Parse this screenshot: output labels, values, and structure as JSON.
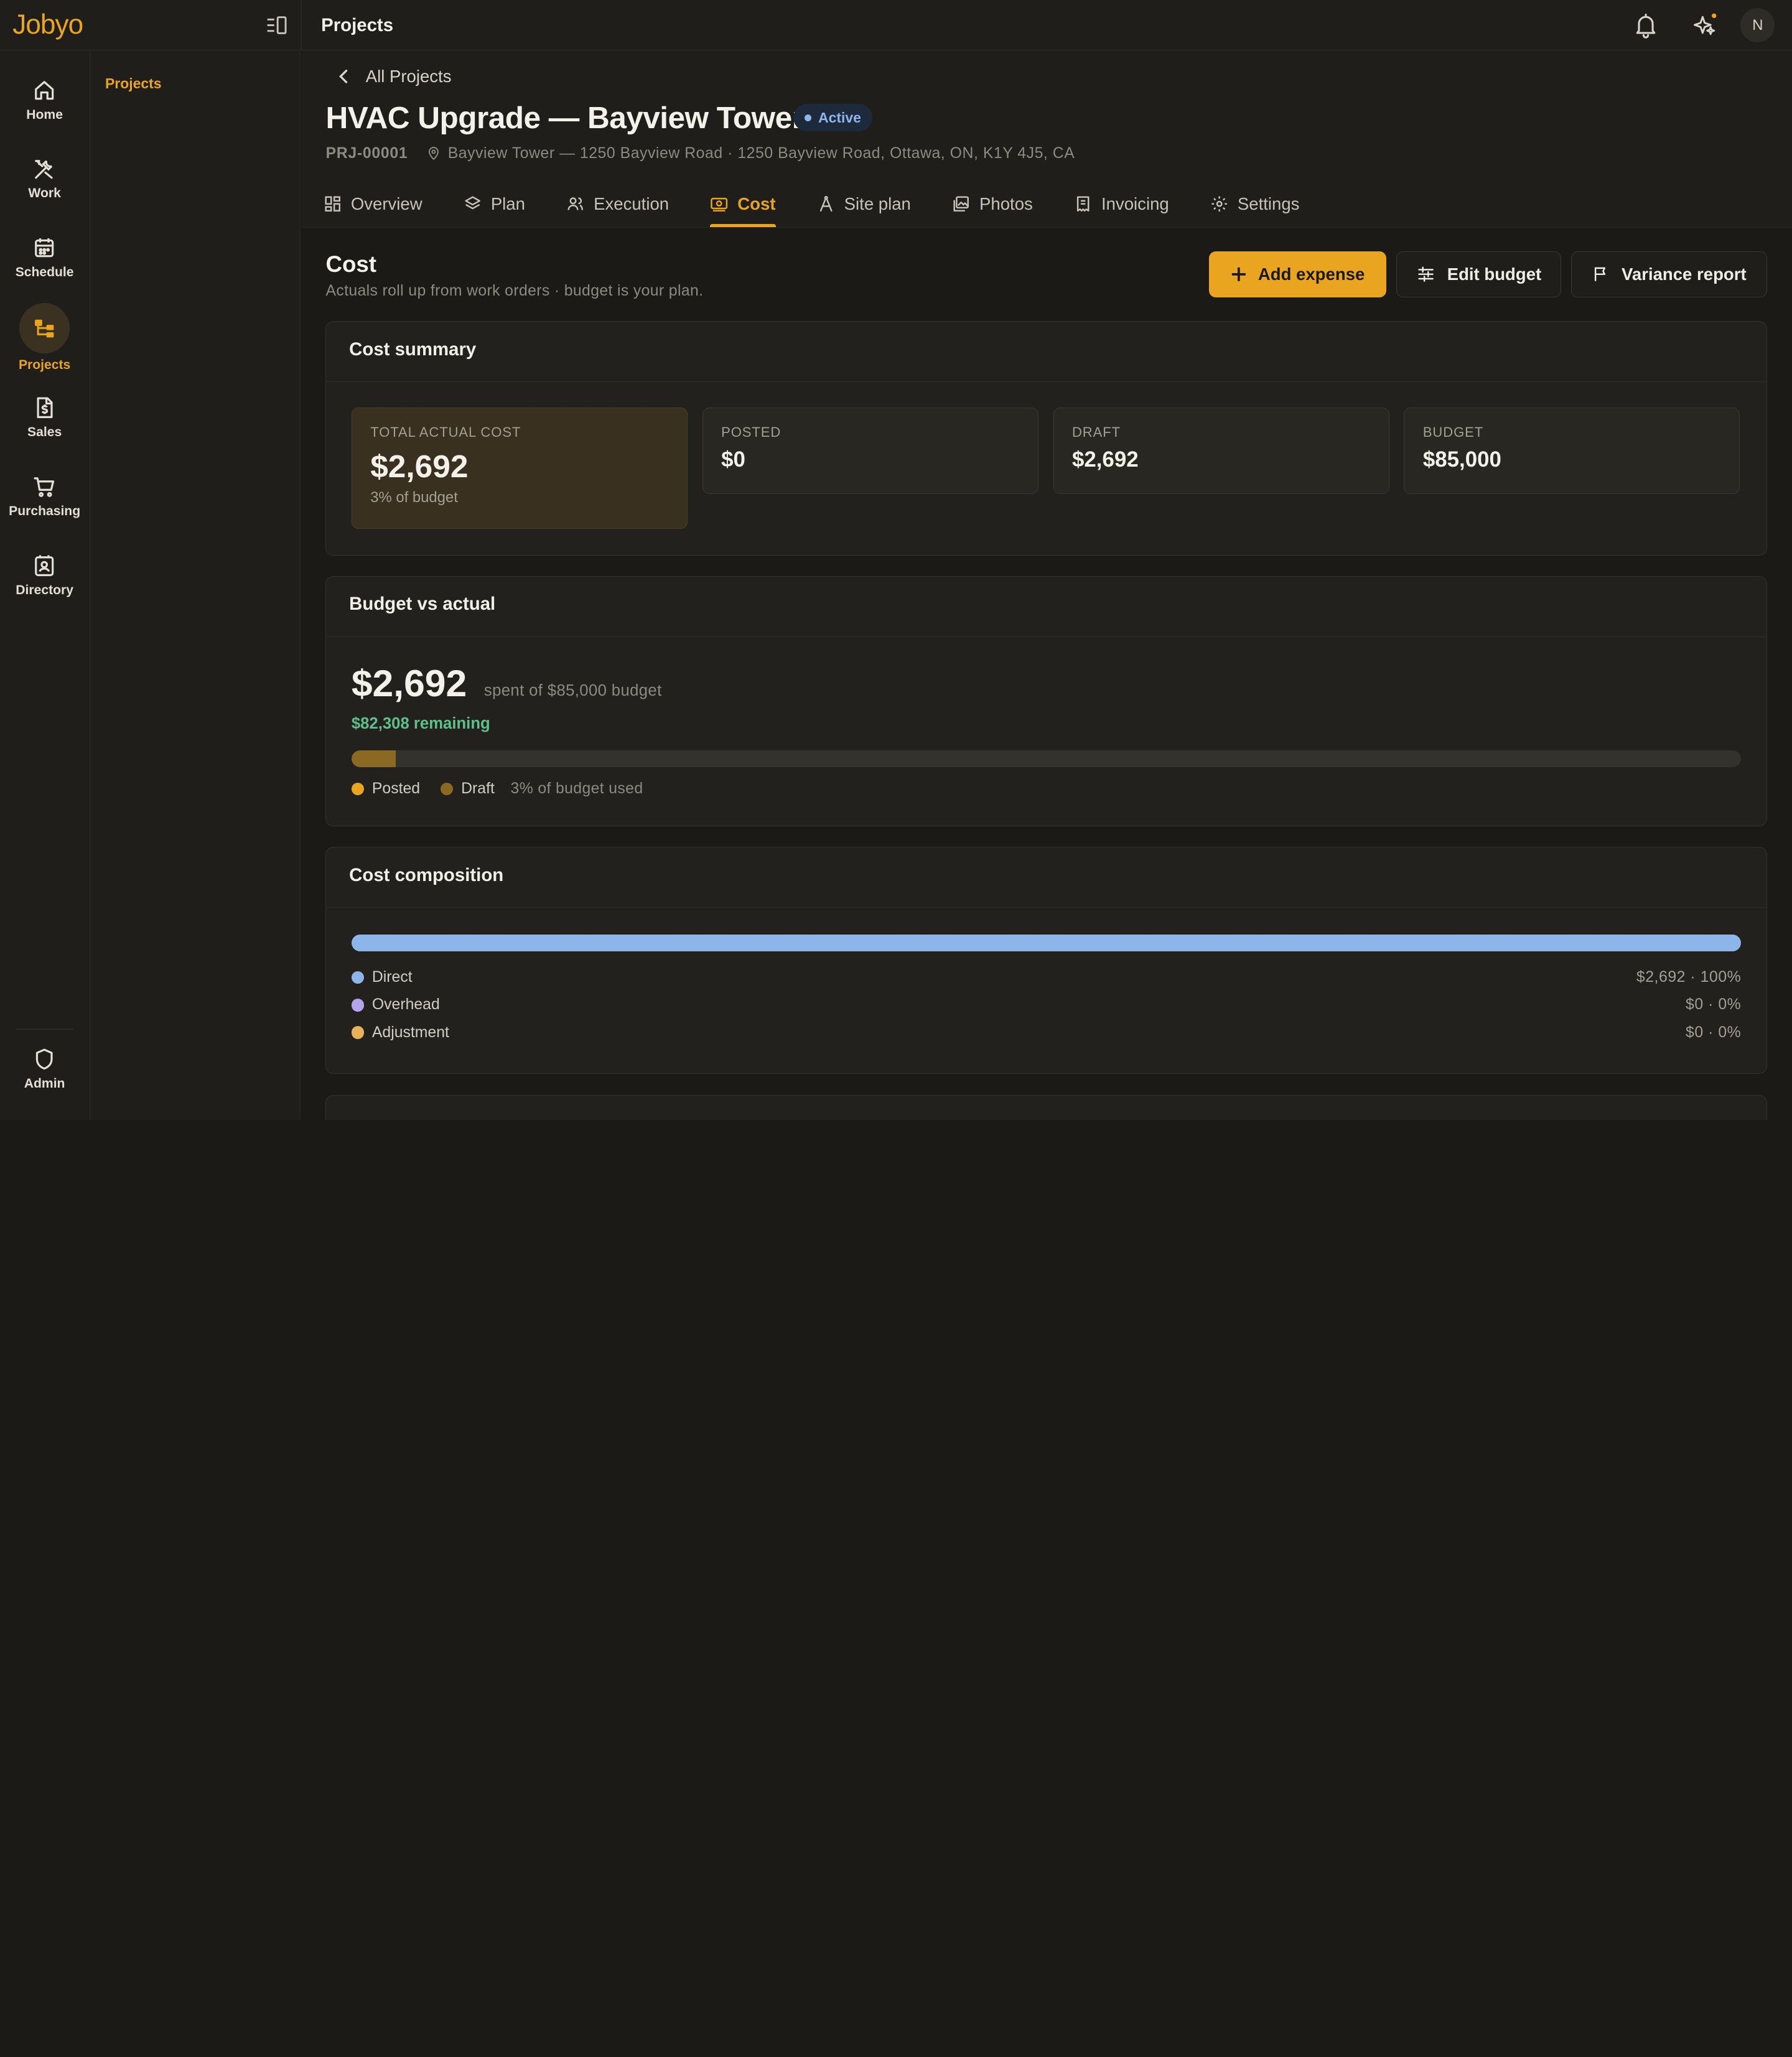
{
  "app": {
    "logo": "Jobyo",
    "top_title": "Projects",
    "avatar_initial": "N"
  },
  "rail": {
    "items": [
      {
        "label": "Home",
        "icon": "home-icon"
      },
      {
        "label": "Work",
        "icon": "tools-icon"
      },
      {
        "label": "Schedule",
        "icon": "calendar-icon"
      },
      {
        "label": "Projects",
        "icon": "projects-icon",
        "active": true
      },
      {
        "label": "Sales",
        "icon": "invoice-dollar-icon"
      },
      {
        "label": "Purchasing",
        "icon": "cart-icon"
      },
      {
        "label": "Directory",
        "icon": "contacts-icon"
      }
    ],
    "admin": {
      "label": "Admin",
      "icon": "shield-icon"
    }
  },
  "subnav": {
    "items": [
      {
        "label": "Projects",
        "active": true
      }
    ]
  },
  "project": {
    "back_label": "All Projects",
    "title": "HVAC Upgrade — Bayview Tower",
    "status": "Active",
    "code": "PRJ-00001",
    "address": "Bayview Tower — 1250 Bayview Road · 1250 Bayview Road, Ottawa, ON, K1Y 4J5, CA"
  },
  "tabs": [
    {
      "label": "Overview",
      "icon": "grid-icon"
    },
    {
      "label": "Plan",
      "icon": "layers-icon"
    },
    {
      "label": "Execution",
      "icon": "people-icon"
    },
    {
      "label": "Cost",
      "icon": "money-icon",
      "active": true
    },
    {
      "label": "Site plan",
      "icon": "compass-icon"
    },
    {
      "label": "Photos",
      "icon": "photos-icon"
    },
    {
      "label": "Invoicing",
      "icon": "receipt-icon"
    },
    {
      "label": "Settings",
      "icon": "gear-icon"
    }
  ],
  "cost": {
    "title": "Cost",
    "subtitle": "Actuals roll up from work orders · budget is your plan.",
    "actions": {
      "add_expense": "Add expense",
      "edit_budget": "Edit budget",
      "variance_report": "Variance report"
    }
  },
  "summary": {
    "title": "Cost summary",
    "stats": [
      {
        "label": "TOTAL ACTUAL COST",
        "value": "$2,692",
        "note": "3% of budget"
      },
      {
        "label": "POSTED",
        "value": "$0"
      },
      {
        "label": "DRAFT",
        "value": "$2,692"
      },
      {
        "label": "BUDGET",
        "value": "$85,000"
      }
    ]
  },
  "budget_vs_actual": {
    "title": "Budget vs actual",
    "spent": "$2,692",
    "spent_of": "spent of $85,000 budget",
    "remaining": "$82,308 remaining",
    "used_fraction": 0.032,
    "legend": {
      "posted": "Posted",
      "draft": "Draft",
      "used": "3% of budget used"
    }
  },
  "composition": {
    "title": "Cost composition",
    "rows": [
      {
        "label": "Direct",
        "value": "$2,692 · 100%",
        "color": "#8eb5ea"
      },
      {
        "label": "Overhead",
        "value": "$0 · 0%",
        "color": "#b6a4ea"
      },
      {
        "label": "Adjustment",
        "value": "$0 · 0%",
        "color": "#e9b25a"
      }
    ]
  },
  "colors": {
    "accent": "#e9a520",
    "posted": "#e9a520",
    "draft": "#8a6a22",
    "remaining": "#5bc08a",
    "badge": "#8fb3ec"
  }
}
